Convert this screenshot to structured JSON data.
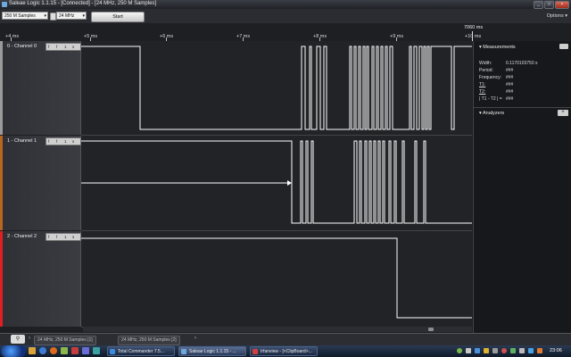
{
  "window": {
    "title": "Saleae Logic 1.1.15 - [Connected] - [24 MHz, 250 M Samples]",
    "controls": [
      "_",
      "□",
      "×"
    ]
  },
  "toolbar": {
    "samples_value": "250 M Samples",
    "rate_value": "24 MHz",
    "start_label": "Start",
    "options_label": "Options ▾"
  },
  "ruler": {
    "ticks": [
      "+4 ms",
      "+5 ms",
      "+6 ms",
      "+7 ms",
      "+8 ms",
      "+9 ms",
      "+10 ms"
    ],
    "cursor_time": "7060 ms"
  },
  "channels": [
    {
      "name": "0 - Channel 0",
      "color": "#9a9a9a"
    },
    {
      "name": "1 - Channel 1",
      "color": "#b8661e"
    },
    {
      "name": "2 - Channel 2",
      "color": "#e02020"
    }
  ],
  "channel_tools": {
    "a": "f",
    "b": "f",
    "c": "1",
    "d": "s"
  },
  "measurements": {
    "header": "Measurements",
    "rows": [
      {
        "label": "Width:",
        "value": "0.1170103750 s"
      },
      {
        "label": "Period:",
        "value": "###"
      },
      {
        "label": "Frequency:",
        "value": "###"
      },
      {
        "label": "T1:",
        "value": "###"
      },
      {
        "label": "T2:",
        "value": "###"
      },
      {
        "label": "| T1 - T2 | =",
        "value": "###"
      }
    ]
  },
  "analyzers": {
    "header": "Analyzers",
    "add": "+"
  },
  "tabs": [
    "24 MHz, 250 M Samples [1]",
    "24 MHz, 250 M Samples [2]"
  ],
  "taskbar": {
    "items": [
      "Total Commander 7.5...",
      "Saleae Logic 1.1.15 - ...",
      "Irfanview - [<ClipBoard>..."
    ],
    "clock": "23:06"
  }
}
